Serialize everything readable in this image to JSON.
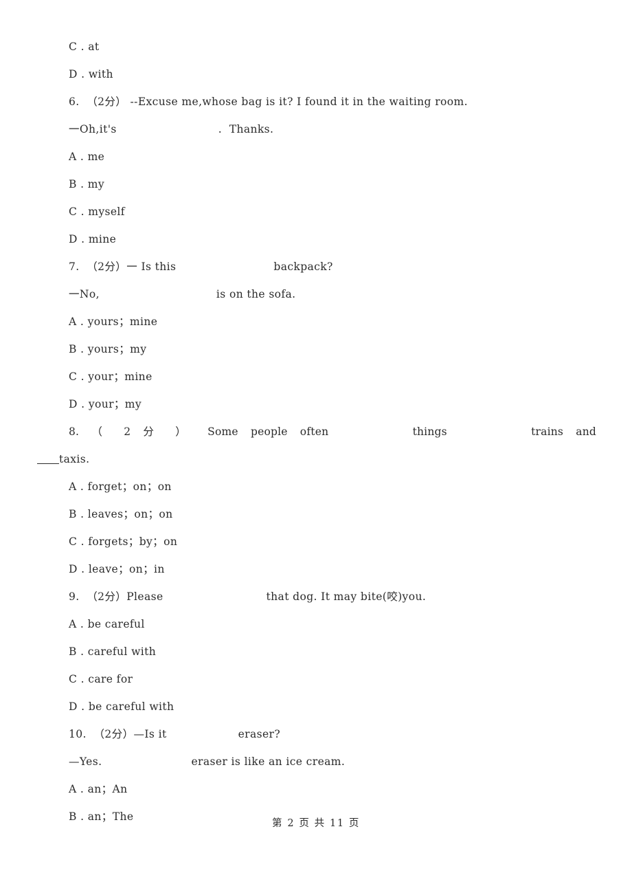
{
  "page": {
    "footer_text": "第 2 页 共 11 页",
    "page_number": "2",
    "total_pages": "11",
    "text_color": "#2b2b2b",
    "background_color": "#ffffff"
  },
  "carryover_options": [
    {
      "label": "C",
      "sep": ".",
      "text": "at"
    },
    {
      "label": "D",
      "sep": ".",
      "text": "with"
    }
  ],
  "questions": [
    {
      "number": "6.",
      "marks": "（2分）",
      "stem_line1": "--Excuse me,whose bag is it? I found it in the waiting room.",
      "stem_line2_pre": "一Oh,it's",
      "stem_line2_post": ".  Thanks.",
      "options": [
        {
          "label": "A",
          "sep": ".",
          "text": "me"
        },
        {
          "label": "B",
          "sep": ".",
          "text": "my"
        },
        {
          "label": "C",
          "sep": ".",
          "text": "myself"
        },
        {
          "label": "D",
          "sep": ".",
          "text": "mine"
        }
      ]
    },
    {
      "number": "7.",
      "marks": "（2分）",
      "stem_line1_pre": "一 Is this",
      "stem_line1_post": "backpack?",
      "stem_line2_pre": "一No,",
      "stem_line2_post": "is on the sofa.",
      "options": [
        {
          "label": "A",
          "sep": ".",
          "text": "yours；mine"
        },
        {
          "label": "B",
          "sep": ".",
          "text": "yours；my"
        },
        {
          "label": "C",
          "sep": ".",
          "text": "your；mine"
        },
        {
          "label": "D",
          "sep": ".",
          "text": "your；my"
        }
      ]
    },
    {
      "number": "8.",
      "marks": "（ 2 分 ）",
      "stem_line1_a": "Some",
      "stem_line1_b": "people",
      "stem_line1_c": "often",
      "stem_line1_d": "things",
      "stem_line1_e": "trains",
      "stem_line1_f": "and",
      "stem_line2_blank": "      ",
      "stem_line2_post": "taxis.",
      "options": [
        {
          "label": "A",
          "sep": ".",
          "text": "forget；on；on"
        },
        {
          "label": "B",
          "sep": ".",
          "text": "leaves；on；on"
        },
        {
          "label": "C",
          "sep": ".",
          "text": "forgets；by；on"
        },
        {
          "label": "D",
          "sep": ".",
          "text": "leave；on；in"
        }
      ]
    },
    {
      "number": "9.",
      "marks": "（2分）",
      "stem_line1_pre": "Please",
      "stem_line1_post": "that dog. It may bite(咬)you.",
      "options": [
        {
          "label": "A",
          "sep": ".",
          "text": "be careful"
        },
        {
          "label": "B",
          "sep": ".",
          "text": "careful with"
        },
        {
          "label": "C",
          "sep": ".",
          "text": "care for"
        },
        {
          "label": "D",
          "sep": ".",
          "text": "be careful with"
        }
      ]
    },
    {
      "number": "10.",
      "marks": "（2分）",
      "stem_line1_pre": "—Is it",
      "stem_line1_post": "eraser?",
      "stem_line2_pre": "—Yes.",
      "stem_line2_post": "eraser is like an ice cream.",
      "options": [
        {
          "label": "A",
          "sep": ".",
          "text": "an；An"
        },
        {
          "label": "B",
          "sep": ".",
          "text": "an；The"
        }
      ]
    }
  ]
}
